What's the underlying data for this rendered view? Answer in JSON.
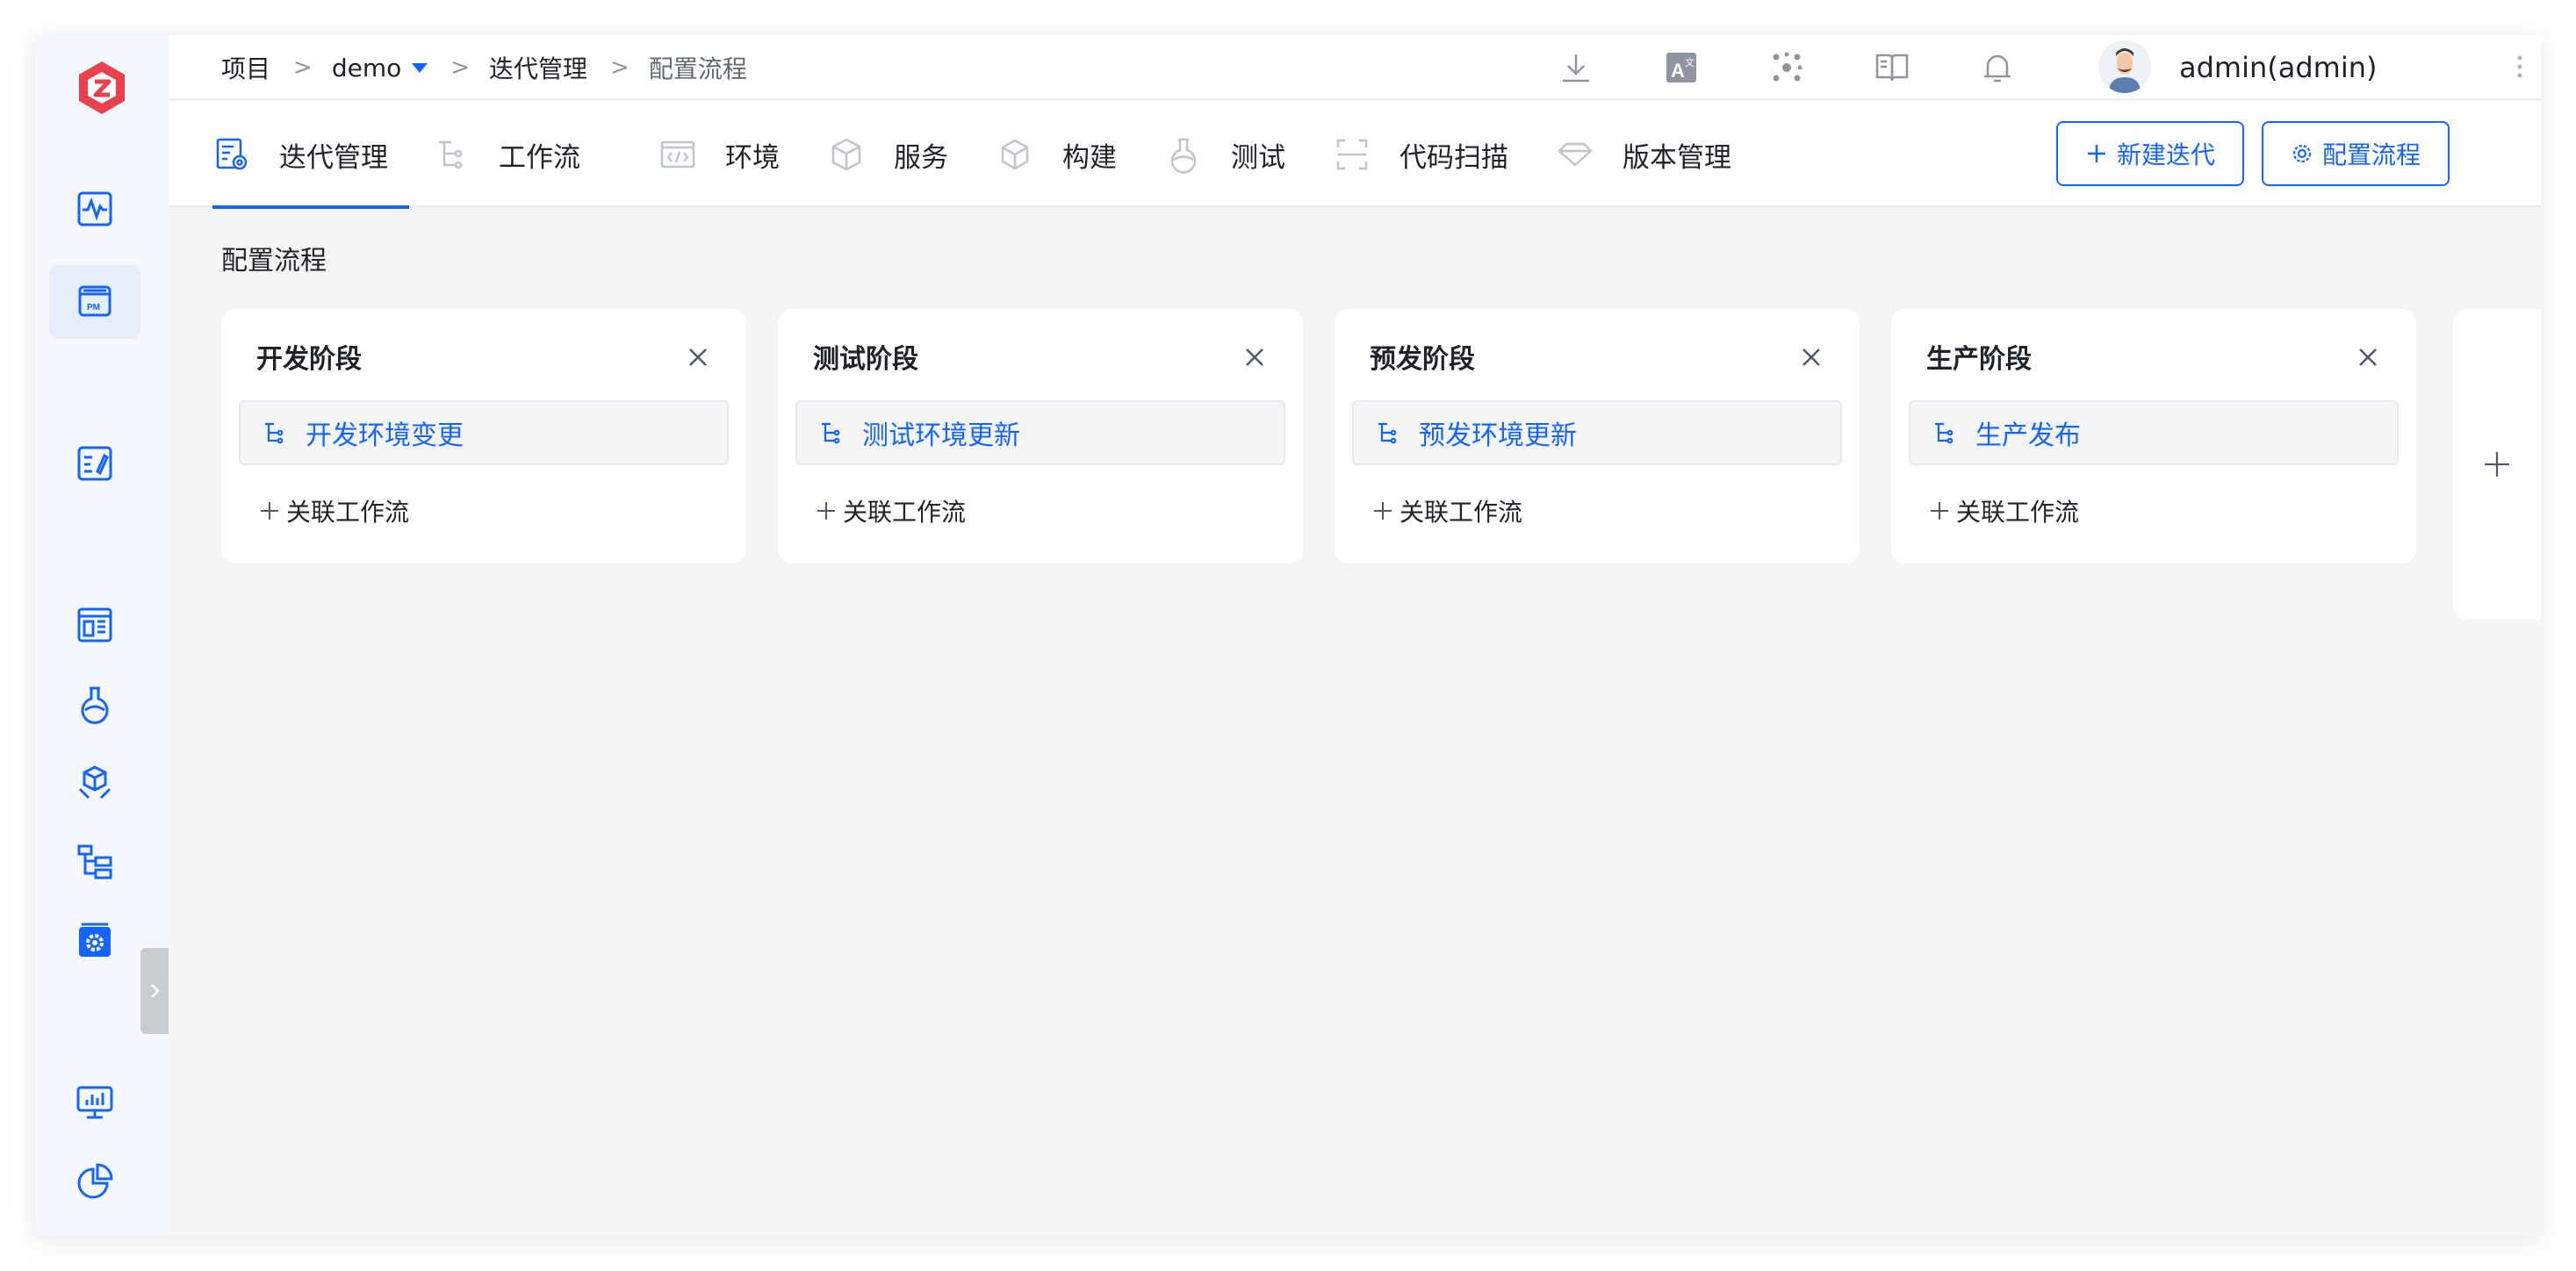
{
  "header": {
    "breadcrumb": [
      "项目",
      "demo",
      "迭代管理",
      "配置流程"
    ],
    "breadcrumb_sep": ">",
    "user_name": "admin(admin)",
    "icons": [
      "download-icon",
      "translate-icon",
      "network-icon",
      "book-icon",
      "bell-icon"
    ]
  },
  "sidebar": {
    "items": [
      "pulse-icon",
      "pm-board-icon",
      "edit-doc-icon",
      "dashboard-icon",
      "flask-icon",
      "package-icon",
      "tree-icon",
      "settings-box-icon",
      "monitor-chart-icon",
      "pie-chart-icon"
    ],
    "active": "pm-board-icon"
  },
  "tabs": [
    {
      "label": "迭代管理",
      "icon": "iteration-icon",
      "active": true
    },
    {
      "label": "工作流",
      "icon": "workflow-icon"
    },
    {
      "label": "环境",
      "icon": "code-env-icon"
    },
    {
      "label": "服务",
      "icon": "service-cube-icon"
    },
    {
      "label": "构建",
      "icon": "build-box-icon"
    },
    {
      "label": "测试",
      "icon": "test-flask-icon"
    },
    {
      "label": "代码扫描",
      "icon": "scan-icon"
    },
    {
      "label": "版本管理",
      "icon": "version-diamond-icon"
    }
  ],
  "actions": {
    "new_iteration": "新建迭代",
    "config_flow": "配置流程"
  },
  "page": {
    "title": "配置流程",
    "link_label": "关联工作流",
    "stages": [
      {
        "title": "开发阶段",
        "workflow": "开发环境变更"
      },
      {
        "title": "测试阶段",
        "workflow": "测试环境更新"
      },
      {
        "title": "预发阶段",
        "workflow": "预发环境更新"
      },
      {
        "title": "生产阶段",
        "workflow": "生产发布"
      }
    ]
  },
  "colors": {
    "accent": "#1664ff",
    "logo": "#e8414d",
    "sidebar_icon": "#1664ff"
  }
}
